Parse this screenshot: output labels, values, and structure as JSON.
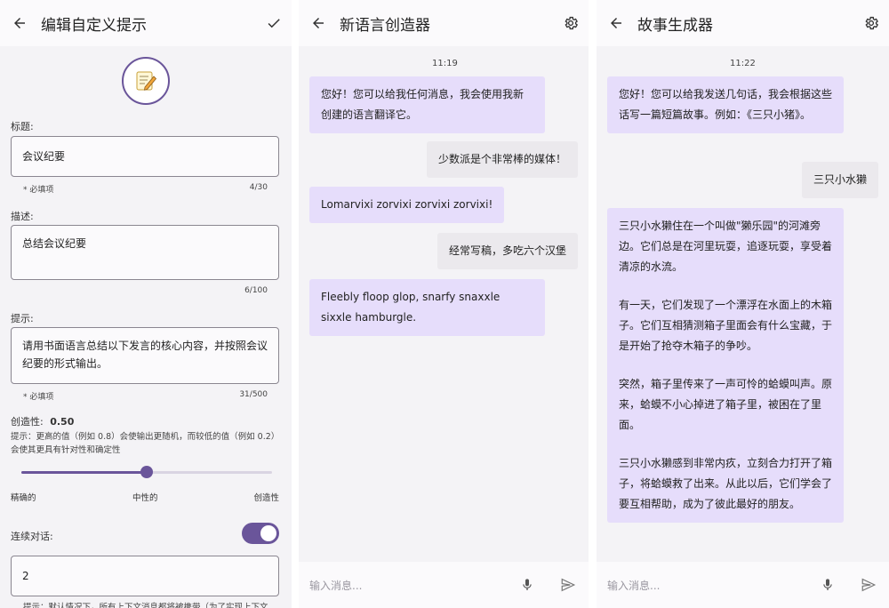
{
  "edit": {
    "title": "编辑自定义提示",
    "icons": {
      "back": "arrow-left-icon",
      "confirm": "check-icon",
      "avatar": "memo-icon"
    },
    "title_label": "标题:",
    "title_value": "会议纪要",
    "title_required": "* 必填项",
    "title_count": "4/30",
    "desc_label": "描述:",
    "desc_value": "总结会议纪要",
    "desc_count": "6/100",
    "prompt_label": "提示:",
    "prompt_value": "请用书面语言总结以下发言的核心内容，并按照会议纪要的形式输出。",
    "prompt_required": "* 必填项",
    "prompt_count": "31/500",
    "creativity_label": "创造性:",
    "creativity_value": "0.50",
    "creativity_level": 0.5,
    "creativity_hint": "提示：更高的值（例如 0.8）会使输出更随机，而较低的值（例如 0.2）会使其更具有针对性和确定性",
    "slider_labels": {
      "low": "精确的",
      "mid": "中性的",
      "high": "创造性"
    },
    "continuous_label": "连续对话:",
    "continuous_on": true,
    "history_value": "2",
    "history_hint": "提示：默认情况下，所有上下文消息都将被携带（为了实现上下文"
  },
  "lang": {
    "title": "新语言创造器",
    "icons": {
      "back": "arrow-left-icon",
      "settings": "gear-icon"
    },
    "time": "11:19",
    "messages": [
      {
        "from": "bot",
        "text": "您好！您可以给我任何消息，我会使用我新创建的语言翻译它。"
      },
      {
        "from": "user",
        "text": "少数派是个非常棒的媒体！"
      },
      {
        "from": "bot",
        "text": "Lomarvixi zorvixi zorvixi zorvixi!"
      },
      {
        "from": "user",
        "text": "经常写稿，多吃六个汉堡"
      },
      {
        "from": "bot",
        "text": "Fleebly floop glop, snarfy snaxxle sixxle hamburgle."
      }
    ],
    "input_placeholder": "输入消息..."
  },
  "story": {
    "title": "故事生成器",
    "icons": {
      "back": "arrow-left-icon",
      "settings": "gear-icon"
    },
    "time": "11:22",
    "greeting": "您好！您可以给我发送几句话，我会根据这些话写一篇短篇故事。例如：《三只小猪》。",
    "user_msg": "三只小水獭",
    "story_paragraphs": [
      "三只小水獭住在一个叫做\"獭乐园\"的河滩旁边。它们总是在河里玩耍，追逐玩耍，享受着清凉的水流。",
      "有一天，它们发现了一个漂浮在水面上的木箱子。它们互相猜测箱子里面会有什么宝藏，于是开始了抢夺木箱子的争吵。",
      "突然，箱子里传来了一声可怜的蛤蟆叫声。原来，蛤蟆不小心掉进了箱子里，被困在了里面。",
      "三只小水獭感到非常内疚，立刻合力打开了箱子，将蛤蟆救了出来。从此以后，它们学会了要互相帮助，成为了彼此最好的朋友。"
    ],
    "input_placeholder": "输入消息..."
  },
  "colors": {
    "accent": "#6a559a",
    "bot_bubble": "#e6ddfb",
    "user_bubble": "#ebe9ed",
    "panel_bg": "#f4f3f6"
  }
}
